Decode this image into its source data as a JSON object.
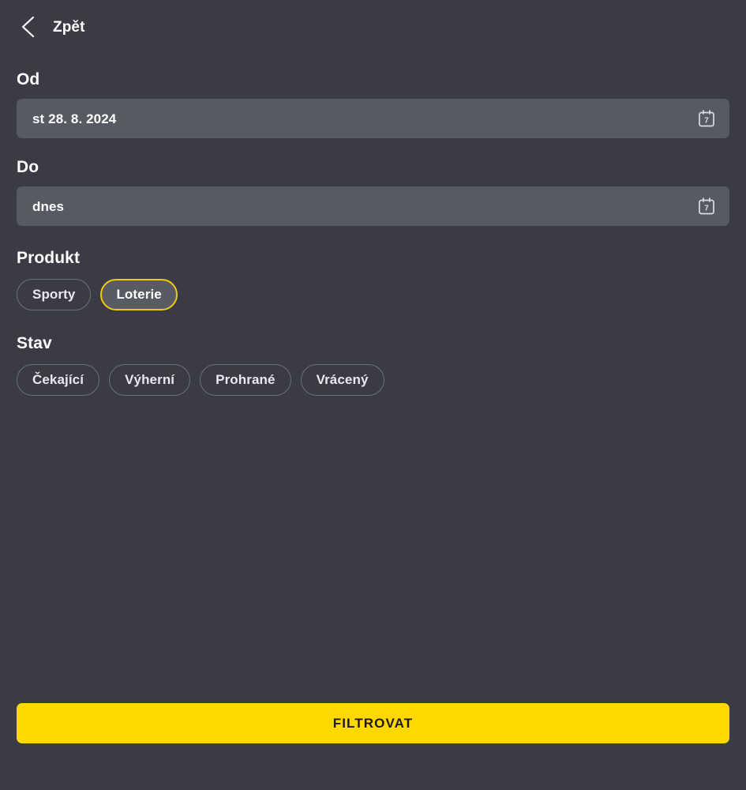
{
  "header": {
    "back_label": "Zpět",
    "back_icon": "chevron-left-icon"
  },
  "sections": {
    "from": {
      "label": "Od",
      "value": "st 28. 8. 2024",
      "placeholder": "st 28. 8. 2024",
      "icon": "calendar-icon",
      "icon_day": "7"
    },
    "to": {
      "label": "Do",
      "value": "dnes",
      "placeholder": "dnes",
      "icon": "calendar-icon",
      "icon_day": "7"
    },
    "product": {
      "label": "Produkt",
      "chips": [
        {
          "label": "Sporty",
          "selected": false
        },
        {
          "label": "Loterie",
          "selected": true
        }
      ]
    },
    "status": {
      "label": "Stav",
      "chips": [
        {
          "label": "Čekající",
          "selected": false
        },
        {
          "label": "Výherní",
          "selected": false
        },
        {
          "label": "Prohrané",
          "selected": false
        },
        {
          "label": "Vrácený",
          "selected": false
        }
      ]
    }
  },
  "footer": {
    "filter_label": "FILTROVAT"
  },
  "colors": {
    "background": "#3a3b45",
    "field_background": "#585a63",
    "accent_yellow": "#ffd800",
    "chip_selected_border": "#f2cb06",
    "chip_border": "#6d6f79",
    "text_primary": "#ffffff",
    "button_text": "#1b1b1f"
  }
}
